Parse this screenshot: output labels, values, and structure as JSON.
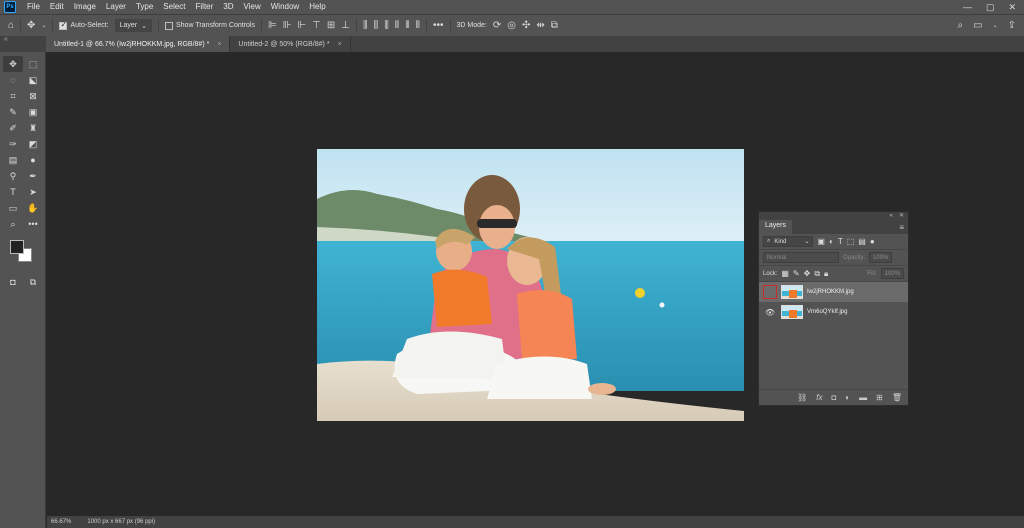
{
  "app": {
    "logo": "Ps"
  },
  "menubar": {
    "items": [
      "File",
      "Edit",
      "Image",
      "Layer",
      "Type",
      "Select",
      "Filter",
      "3D",
      "View",
      "Window",
      "Help"
    ],
    "window_controls": [
      "—",
      "▢",
      "✕"
    ]
  },
  "options_bar": {
    "auto_select_label": "Auto-Select:",
    "auto_select_target": "Layer",
    "transform_controls_label": "Show Transform Controls",
    "more_label": "•••",
    "mode_3d_label": "3D Mode:"
  },
  "tabs": [
    {
      "label": "Untitled-1 @ 66.7% (Iw2jRHOKKM.jpg, RGB/8#) *",
      "active": true
    },
    {
      "label": "Untitled-2 @ 50% (RGB/8#) *",
      "active": false
    }
  ],
  "statusbar": {
    "zoom": "66.67%",
    "doc_info": "1000 px x 667 px (96 ppi)"
  },
  "layers_panel": {
    "tab_label": "Layers",
    "filter_kind": "Kind",
    "blend_mode": "Normal",
    "opacity_label": "Opacity:",
    "opacity_value": "100%",
    "lock_label": "Lock:",
    "fill_label": "Fill:",
    "fill_value": "100%",
    "layers": [
      {
        "name": "Iw2jRHOKKM.jpg",
        "visible": false,
        "selected": true
      },
      {
        "name": "Vrn6oQYkIf.jpg",
        "visible": true,
        "selected": false
      }
    ]
  },
  "colors": {
    "accent_highlight": "#cc2b2b",
    "ui_bg": "#535353",
    "canvas_bg": "#282828"
  }
}
